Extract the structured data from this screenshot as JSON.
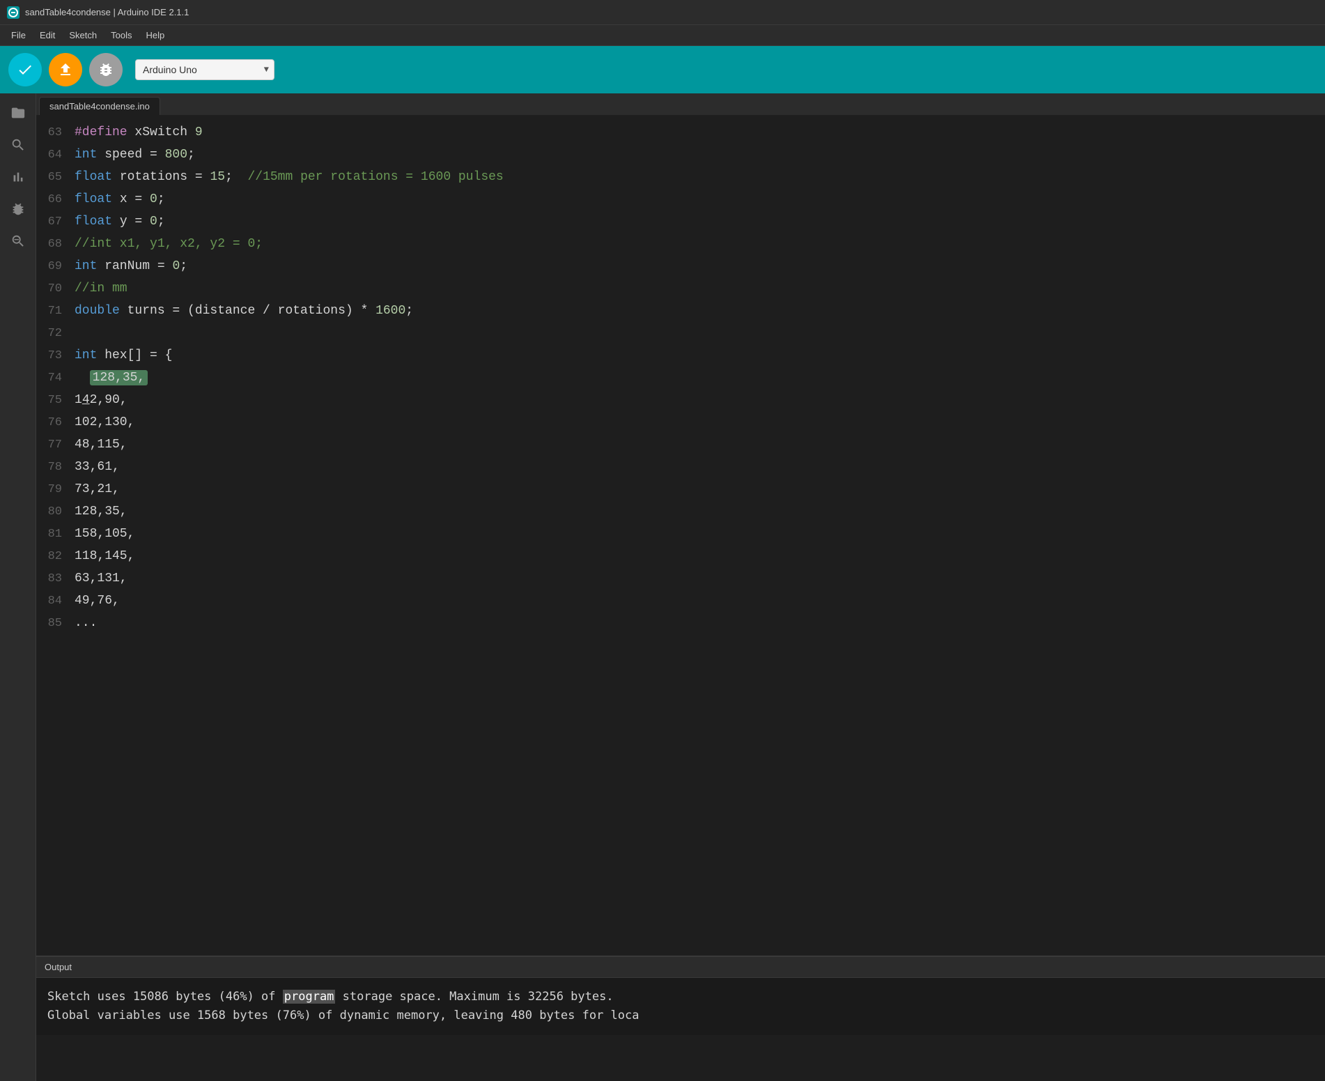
{
  "window": {
    "title": "sandTable4condense | Arduino IDE 2.1.1",
    "icon_label": "arduino-logo"
  },
  "menu": {
    "items": [
      "File",
      "Edit",
      "Sketch",
      "Tools",
      "Help"
    ]
  },
  "toolbar": {
    "verify_label": "Verify",
    "upload_label": "Upload",
    "debug_label": "Debug",
    "board": "Arduino Uno"
  },
  "sidebar": {
    "icons": [
      {
        "name": "folder-icon",
        "symbol": "📁"
      },
      {
        "name": "search-icon",
        "symbol": "🔍"
      },
      {
        "name": "chart-icon",
        "symbol": "📊"
      },
      {
        "name": "debug-side-icon",
        "symbol": "🐞"
      },
      {
        "name": "find-icon",
        "symbol": "🔎"
      }
    ]
  },
  "file_tab": {
    "label": "sandTable4condense.ino"
  },
  "code_lines": [
    {
      "num": "63",
      "content": "#define xSwitch 9",
      "type": "define"
    },
    {
      "num": "64",
      "content": "int speed = 800;",
      "type": "decl"
    },
    {
      "num": "65",
      "content": "float rotations = 15;  //15mm per rotations = 1600 pulses",
      "type": "decl"
    },
    {
      "num": "66",
      "content": "float x = 0;",
      "type": "decl"
    },
    {
      "num": "67",
      "content": "float y = 0;",
      "type": "decl"
    },
    {
      "num": "68",
      "content": "//int x1, y1, x2, y2 = 0;",
      "type": "comment"
    },
    {
      "num": "69",
      "content": "int ranNum = 0;",
      "type": "decl"
    },
    {
      "num": "70",
      "content": "//in mm",
      "type": "comment"
    },
    {
      "num": "71",
      "content": "double turns = (distance / rotations) * 1600;",
      "type": "decl"
    },
    {
      "num": "72",
      "content": "",
      "type": "blank"
    },
    {
      "num": "73",
      "content": "int hex[] = {",
      "type": "decl"
    },
    {
      "num": "74",
      "content": "  128,35,",
      "type": "highlight"
    },
    {
      "num": "75",
      "content": "142,90,",
      "type": "data"
    },
    {
      "num": "76",
      "content": "102,130,",
      "type": "data"
    },
    {
      "num": "77",
      "content": "48,115,",
      "type": "data"
    },
    {
      "num": "78",
      "content": "33,61,",
      "type": "data"
    },
    {
      "num": "79",
      "content": "73,21,",
      "type": "data"
    },
    {
      "num": "80",
      "content": "128,35,",
      "type": "data"
    },
    {
      "num": "81",
      "content": "158,105,",
      "type": "data"
    },
    {
      "num": "82",
      "content": "118,145,",
      "type": "data"
    },
    {
      "num": "83",
      "content": "63,131,",
      "type": "data"
    },
    {
      "num": "84",
      "content": "49,76,",
      "type": "data"
    },
    {
      "num": "85",
      "content": "...",
      "type": "data"
    }
  ],
  "output": {
    "tab_label": "Output",
    "lines": [
      "Sketch uses 15086 bytes (46%) of program storage space. Maximum is 32256 bytes.",
      "Global variables use 1568 bytes (76%) of dynamic memory, leaving 480 bytes for loca"
    ],
    "highlight_word": "program"
  }
}
